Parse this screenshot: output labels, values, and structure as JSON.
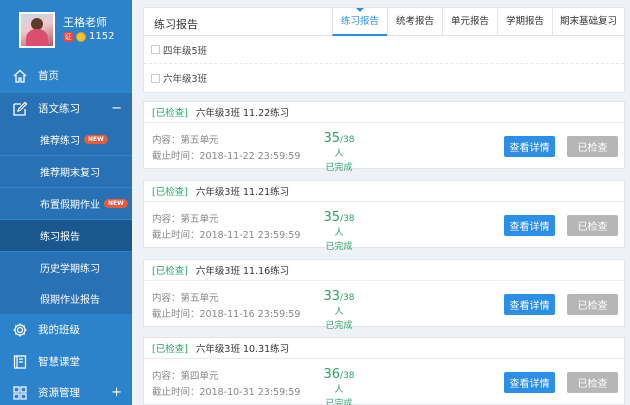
{
  "profile": {
    "name": "王格老师",
    "level_badge": "证",
    "coins": "1152"
  },
  "nav": {
    "home": "首页",
    "chinese_practice": "语文练习",
    "collapse_symbol": "−",
    "sub": {
      "recommend_practice": "推荐练习",
      "final_review": "推荐期末复习",
      "holiday_homework": "布置假期作业",
      "practice_report": "练习报告",
      "history_practice": "历史学期练习",
      "holiday_report": "假期作业报告"
    },
    "new_badge": "NEW",
    "my_class": "我的班级",
    "smart_class": "智慧课堂",
    "resources": "资源管理",
    "expand_symbol": "+"
  },
  "panel": {
    "title": "练习报告",
    "tabs": [
      "练习报告",
      "统考报告",
      "单元报告",
      "学期报告",
      "期末基础复习"
    ],
    "classes": [
      "四年级5班",
      "六年级3班"
    ]
  },
  "cards": [
    {
      "tag": "[已检查]",
      "title": "六年级3班   11.22练习",
      "content": "内容：第五单元",
      "deadline": "截止时间：2018-11-22 23:59:59",
      "done": "35",
      "total": "/38人",
      "status": "已完成",
      "detail_btn": "查看详情",
      "checked_btn": "已检查"
    },
    {
      "tag": "[已检查]",
      "title": "六年级3班   11.21练习",
      "content": "内容：第五单元",
      "deadline": "截止时间：2018-11-21 23:59:59",
      "done": "35",
      "total": "/38人",
      "status": "已完成",
      "detail_btn": "查看详情",
      "checked_btn": "已检查"
    },
    {
      "tag": "[已检查]",
      "title": "六年级3班   11.16练习",
      "content": "内容：第五单元",
      "deadline": "截止时间：2018-11-16 23:59:59",
      "done": "33",
      "total": "/38人",
      "status": "已完成",
      "detail_btn": "查看详情",
      "checked_btn": "已检查"
    },
    {
      "tag": "[已检查]",
      "title": "六年级3班   10.31练习",
      "content": "内容：第四单元",
      "deadline": "截止时间：2018-10-31 23:59:59",
      "done": "36",
      "total": "/38人",
      "status": "已完成",
      "detail_btn": "查看详情",
      "checked_btn": "已检查"
    }
  ]
}
